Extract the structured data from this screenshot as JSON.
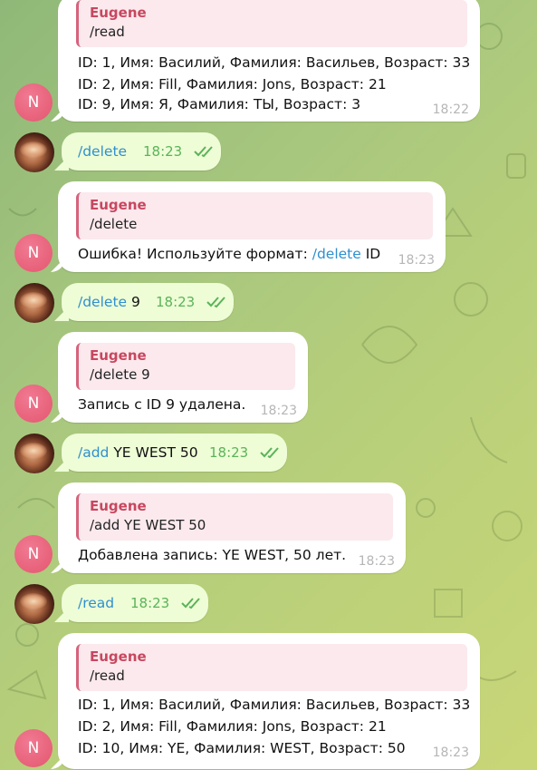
{
  "avatars": {
    "bot_letter": "N"
  },
  "messages": [
    {
      "reply_name": "Eugene",
      "reply_text": "/read",
      "lines": [
        "ID: 1, Имя: Василий, Фамилия: Васильев, Возраст: 33",
        "ID: 2, Имя: Fill, Фамилия: Jons, Возраст: 21",
        "ID: 9, Имя: Я, Фамилия: ТЫ, Возраст: 3"
      ],
      "time": "18:22"
    },
    {
      "cmd": "/delete",
      "arg": "",
      "time": "18:23"
    },
    {
      "reply_name": "Eugene",
      "reply_text": "/delete",
      "line_prefix": "Ошибка! Используйте формат: ",
      "line_cmd": "/delete",
      "line_suffix": " ID",
      "time": "18:23"
    },
    {
      "cmd": "/delete",
      "arg": " 9",
      "time": "18:23"
    },
    {
      "reply_name": "Eugene",
      "reply_text": "/delete 9",
      "lines": [
        "Запись с ID 9 удалена."
      ],
      "time": "18:23"
    },
    {
      "cmd": "/add",
      "arg": " YE WEST 50",
      "time": "18:23"
    },
    {
      "reply_name": "Eugene",
      "reply_text": "/add YE WEST 50",
      "lines": [
        "Добавлена запись: YE WEST, 50 лет."
      ],
      "time": "18:23"
    },
    {
      "cmd": "/read",
      "arg": "",
      "time": "18:23"
    },
    {
      "reply_name": "Eugene",
      "reply_text": "/read",
      "lines": [
        "ID: 1, Имя: Василий, Фамилия: Васильев, Возраст: 33",
        "ID: 2, Имя: Fill, Фамилия: Jons, Возраст: 21",
        "ID: 10, Имя: YE, Фамилия: WEST, Возраст: 50"
      ],
      "time": "18:23"
    }
  ],
  "colors": {
    "accent": "#2f8fcf",
    "reply_accent": "#c8475f",
    "outgoing_bg": "#eefdd6",
    "check": "#5ab35a"
  },
  "icons": {
    "read_status": "double-check-icon"
  }
}
